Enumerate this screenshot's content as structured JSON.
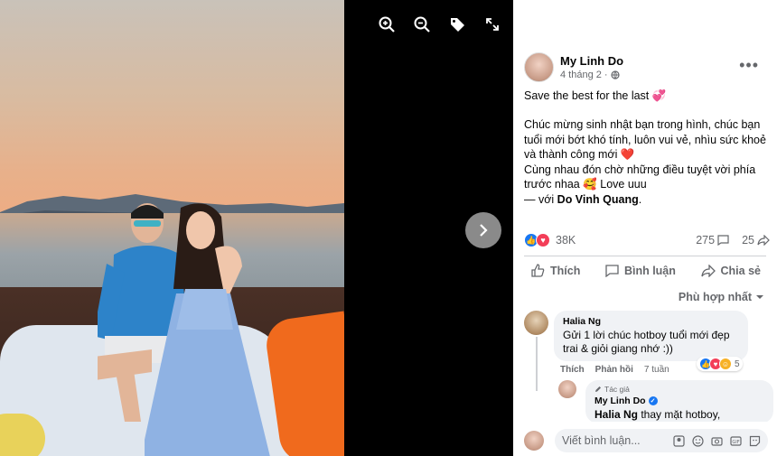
{
  "toolbar": {
    "zoom_in": "zoom-in-icon",
    "zoom_out": "zoom-out-icon",
    "tag": "tag-icon",
    "fullscreen": "fullscreen-icon"
  },
  "post": {
    "author": "My Linh Do",
    "time": "4 tháng 2",
    "privacy_icon": "globe-icon",
    "line1": "Save the best for the last 💞",
    "line2": "Chúc mừng sinh nhật bạn trong hình, chúc bạn tuổi mới bớt khó tính, luôn vui vẻ, nhìu sức khoẻ và thành công mới ❤️",
    "line3": "Cùng nhau đón chờ những điều tuyệt vời phía trước nhaa 🥰 Love uuu",
    "with_prefix": "— với ",
    "with_name": "Do Vinh Quang",
    "with_suffix": "."
  },
  "stats": {
    "reactions": "38K",
    "comments": "275",
    "shares": "25"
  },
  "actions": {
    "like": "Thích",
    "comment": "Bình luận",
    "share": "Chia sẻ"
  },
  "sort_label": "Phù hợp nhất",
  "comment": {
    "name": "Halia Ng",
    "text": "Gửi 1 lời chúc hotboy tuổi mới đẹp trai & giỏi giang nhớ :))",
    "like": "Thích",
    "reply": "Phản hồi",
    "time": "7 tuần",
    "reaction_count": "5"
  },
  "reply": {
    "badge": "Tác giả",
    "name": "My Linh Do",
    "mention": "Halia Ng",
    "text": " thay mặt hotboy,"
  },
  "input": {
    "placeholder": "Viết bình luận..."
  },
  "colors": {
    "accent": "#1877f2",
    "love": "#f33e58",
    "muted": "#65676b"
  }
}
